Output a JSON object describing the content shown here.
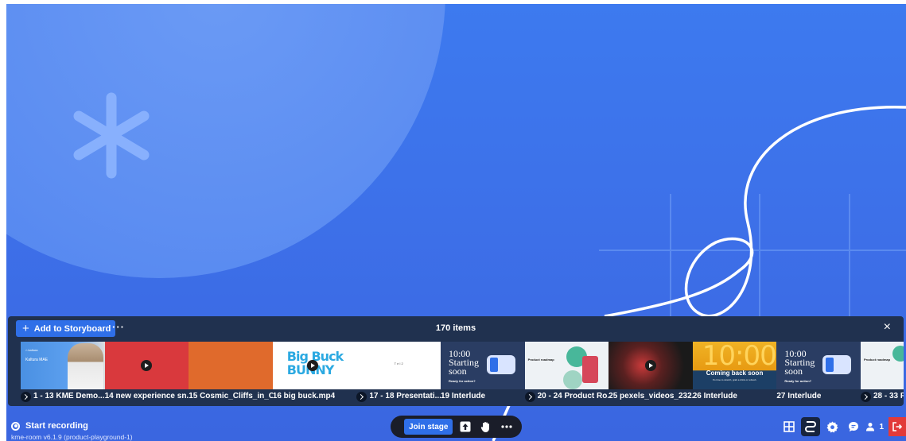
{
  "storyboard": {
    "add_label": "Add to Storyboard",
    "more_label": "···",
    "item_count": "170 items",
    "close_label": "×",
    "thumbnails": [
      {
        "kind": "kme-demo",
        "texts": [
          "⌂ kaltura",
          "Kaltura MAE"
        ]
      },
      {
        "kind": "video-red"
      },
      {
        "kind": "orange"
      },
      {
        "kind": "big-buck",
        "texts": [
          "Big Buck",
          "BUNNY"
        ]
      },
      {
        "kind": "presentation",
        "texts": [
          "T e l 2"
        ]
      },
      {
        "kind": "interlude",
        "texts": [
          "10:00",
          "Starting",
          "soon",
          "Ready for action?"
        ]
      },
      {
        "kind": "product-roadmap",
        "texts": [
          "Product roadmap"
        ]
      },
      {
        "kind": "video-dark"
      },
      {
        "kind": "coming-back",
        "texts": [
          "10:00",
          "Coming back soon",
          "It's time to stretch, grab a drink or refresh."
        ]
      },
      {
        "kind": "interlude",
        "texts": [
          "10:00",
          "Starting",
          "soon",
          "Ready for action?"
        ]
      },
      {
        "kind": "product-roadmap",
        "texts": [
          "Product roadmap"
        ]
      }
    ],
    "labels": [
      {
        "text": "1 - 13 KME Demo....",
        "group": true
      },
      {
        "text": "14 new experience sn...",
        "group": false
      },
      {
        "text": "15 Cosmic_Cliffs_in_C...",
        "group": false
      },
      {
        "text": "16 big buck.mp4",
        "group": false
      },
      {
        "text": "17 - 18 Presentati...",
        "group": true
      },
      {
        "text": "19 Interlude",
        "group": false
      },
      {
        "text": "20 - 24 Product Ro...",
        "group": true
      },
      {
        "text": "25 pexels_videos_232...",
        "group": false
      },
      {
        "text": "26 Interlude",
        "group": false
      },
      {
        "text": "27 Interlude",
        "group": false
      },
      {
        "text": "28 - 33 P",
        "group": true
      }
    ]
  },
  "bottom_bar": {
    "record_label": "Start recording",
    "version": "kme-room v6.1.9 (product-playground-1)",
    "join_label": "Join stage",
    "participants_count": "1"
  },
  "icons": {
    "share": "upload-icon",
    "raise_hand": "hand-icon",
    "more": "more-icon",
    "layout": "grid-icon",
    "storyboard": "storyboard-icon",
    "settings": "gear-icon",
    "chat": "chat-icon",
    "participants": "person-icon",
    "leave": "exit-icon"
  },
  "colors": {
    "background": "#3f79ee",
    "accent": "#2f6fe8",
    "panel": "#20314f",
    "leave": "#e23a3a"
  }
}
